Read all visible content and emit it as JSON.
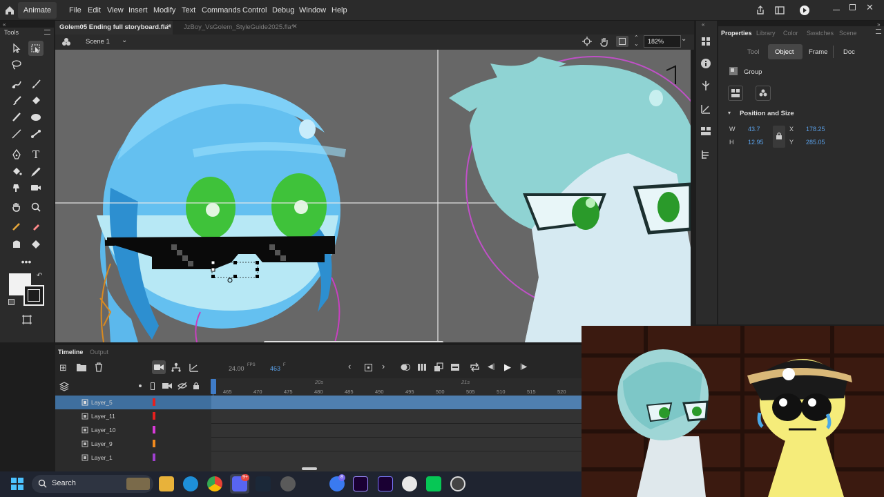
{
  "app": {
    "name": "Animate"
  },
  "menu": [
    "File",
    "Edit",
    "View",
    "Insert",
    "Modify",
    "Text",
    "Commands",
    "Control",
    "Debug",
    "Window",
    "Help"
  ],
  "tools_panel": {
    "title": "Tools"
  },
  "tabs": [
    {
      "label": "Golem05 Ending full storyboard.fla*",
      "active": true
    },
    {
      "label": "JzBoy_VsGolem_StyleGuide2025.fla*",
      "active": false
    }
  ],
  "scene": {
    "label": "Scene 1",
    "zoom": "182%"
  },
  "properties": {
    "tabs": [
      "Properties",
      "Library",
      "Color",
      "Swatches",
      "Scene"
    ],
    "subtabs": [
      "Tool",
      "Object",
      "Frame",
      "Doc"
    ],
    "type_label": "Group",
    "section_title": "Position and Size",
    "w_label": "W",
    "w": "43.7",
    "h_label": "H",
    "h": "12.95",
    "x_label": "X",
    "x": "178.25",
    "y_label": "Y",
    "y": "285.05"
  },
  "timeline": {
    "tabs": [
      "Timeline",
      "Output"
    ],
    "fps": "24.00",
    "fps_unit": "FPS",
    "frame": "463",
    "frame_unit": "F",
    "ruler_labels": [
      "465",
      "470",
      "475",
      "480",
      "485",
      "490",
      "495",
      "500",
      "505",
      "510",
      "515",
      "520"
    ],
    "second_markers": [
      "20s",
      "21s"
    ],
    "layers": [
      {
        "name": "Layer_5",
        "color": "#e8201e",
        "selected": true
      },
      {
        "name": "Layer_11",
        "color": "#e8201e",
        "selected": false
      },
      {
        "name": "Layer_10",
        "color": "#d83ad8",
        "selected": false
      },
      {
        "name": "Layer_9",
        "color": "#f08a1e",
        "selected": false
      },
      {
        "name": "Layer_1",
        "color": "#a040d0",
        "selected": false
      }
    ]
  },
  "taskbar": {
    "search_label": "Search",
    "discord_badge": "9+",
    "messenger_badge": "8"
  },
  "colors": {
    "accent": "#3f7cc8",
    "stage": "#676767",
    "panel": "#2b2b2b"
  }
}
